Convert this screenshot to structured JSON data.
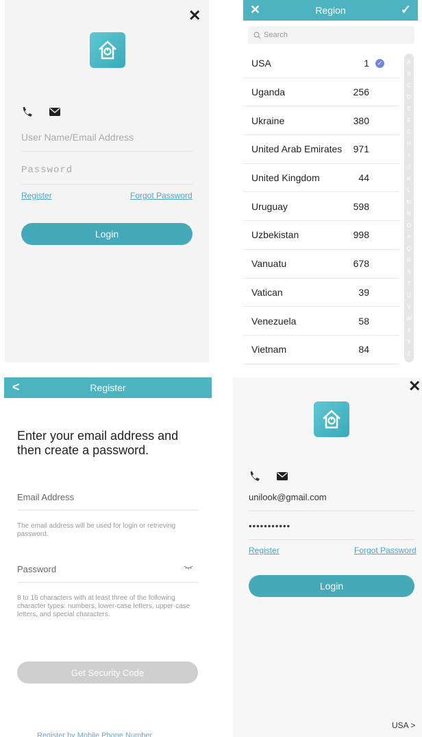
{
  "login": {
    "close": "✕",
    "username_placeholder": "User Name/Email Address",
    "password_placeholder": "Password",
    "register": "Register",
    "forgot": "Forgot Password",
    "login": "Login"
  },
  "region": {
    "title": "Region",
    "close": "✕",
    "confirm": "✓",
    "search_placeholder": "Search",
    "rows": [
      {
        "name": "USA",
        "code": "1",
        "selected": true
      },
      {
        "name": "Uganda",
        "code": "256"
      },
      {
        "name": "Ukraine",
        "code": "380"
      },
      {
        "name": "United Arab Emirates",
        "code": "971"
      },
      {
        "name": "United Kingdom",
        "code": "44"
      },
      {
        "name": "Uruguay",
        "code": "598"
      },
      {
        "name": "Uzbekistan",
        "code": "998"
      },
      {
        "name": "Vanuatu",
        "code": "678"
      },
      {
        "name": "Vatican",
        "code": "39"
      },
      {
        "name": "Venezuela",
        "code": "58"
      },
      {
        "name": "Vietnam",
        "code": "84"
      }
    ],
    "alphabet": [
      "A",
      "B",
      "C",
      "D",
      "E",
      "F",
      "G",
      "H",
      "I",
      "J",
      "K",
      "L",
      "M",
      "N",
      "O",
      "P",
      "Q",
      "R",
      "S",
      "T",
      "U",
      "V",
      "W",
      "X",
      "Y",
      "Z"
    ]
  },
  "register": {
    "back": "<",
    "title": "Register",
    "heading": "Enter your email address and then create a password.",
    "email_placeholder": "Email Address",
    "email_note": "The email address will be used for login or retrieving password.",
    "password_placeholder": "Password",
    "password_note": "8 to 16 characters with at least three of the following character types: numbers, lower-case letters, upper-case letters, and special characters.",
    "get_code": "Get Security Code",
    "bottom_link": "Register by Mobile Phone Number"
  },
  "login_filled": {
    "close": "✕",
    "username": "unilook@gmail.com",
    "password": "•••••••••••",
    "register": "Register",
    "forgot": "Forgot Password",
    "login": "Login",
    "region": "USA >"
  }
}
